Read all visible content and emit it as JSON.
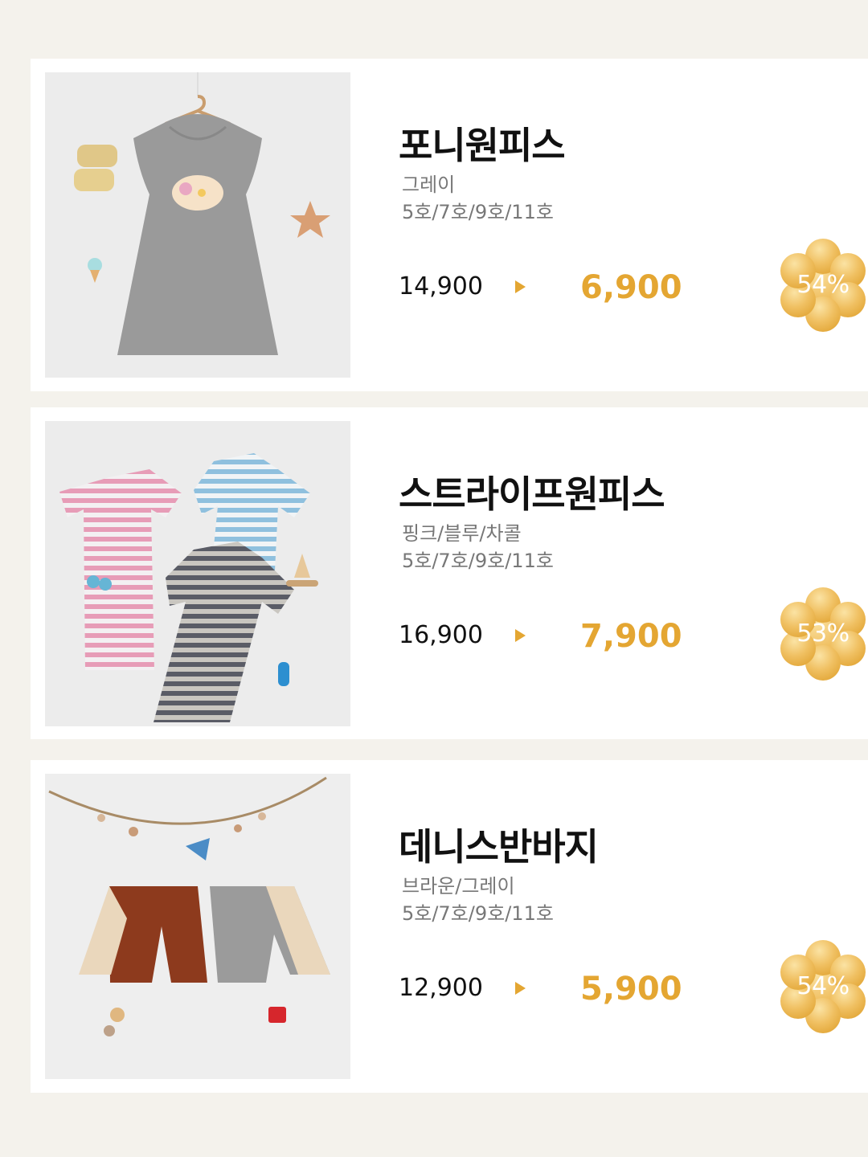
{
  "products": [
    {
      "name": "포니원피스",
      "color": "그레이",
      "sizes": "5호/7호/9호/11호",
      "original_price": "14,900",
      "sale_price": "6,900",
      "discount": "54%"
    },
    {
      "name": "스트라이프원피스",
      "color": "핑크/블루/차콜",
      "sizes": "5호/7호/9호/11호",
      "original_price": "16,900",
      "sale_price": "7,900",
      "discount": "53%"
    },
    {
      "name": "데니스반바지",
      "color": "브라운/그레이",
      "sizes": "5호/7호/9호/11호",
      "original_price": "12,900",
      "sale_price": "5,900",
      "discount": "54%"
    }
  ],
  "colors": {
    "accent": "#e4a632",
    "badge_light": "#fbe3a4",
    "badge_dark": "#e3a83a",
    "background": "#f4f2ec",
    "card": "#ffffff"
  },
  "icons": [
    "arrow-right-icon",
    "flower-badge-icon"
  ]
}
